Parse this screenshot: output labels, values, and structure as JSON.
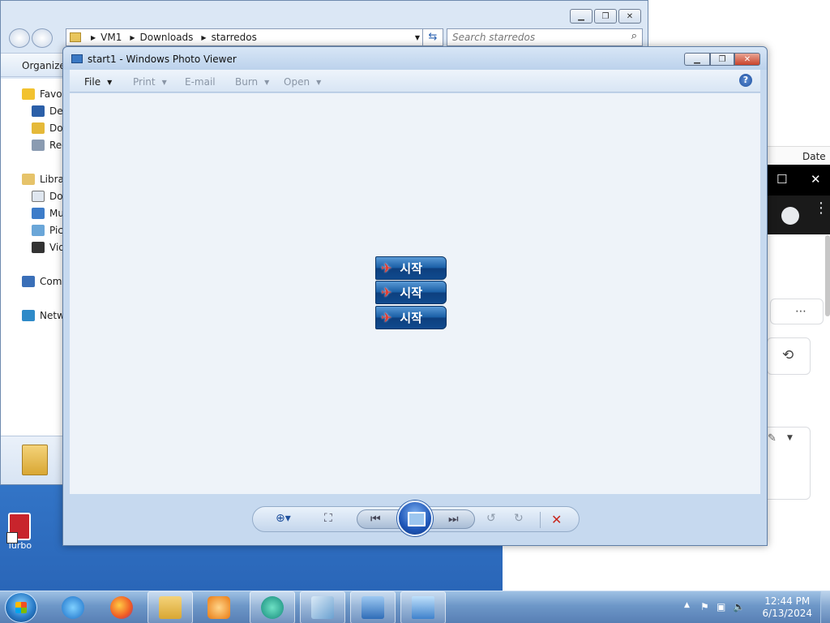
{
  "desktop": {
    "shortcut_label": "Turbo"
  },
  "browser": {
    "date_column": "Date r"
  },
  "explorer": {
    "breadcrumb": [
      "VM1",
      "Downloads",
      "starredos"
    ],
    "search_placeholder": "Search starredos",
    "organize_label": "Organize",
    "nav_items": [
      {
        "label": "Favorites",
        "icon": "star-icon"
      },
      {
        "label": "Desktop",
        "icon": "desktop-icon"
      },
      {
        "label": "Downloads",
        "icon": "downloads-icon"
      },
      {
        "label": "Recent Places",
        "icon": "recent-places-icon"
      },
      {
        "label": "Libraries",
        "icon": "libraries-icon"
      },
      {
        "label": "Documents",
        "icon": "documents-icon"
      },
      {
        "label": "Music",
        "icon": "music-icon"
      },
      {
        "label": "Pictures",
        "icon": "pictures-icon"
      },
      {
        "label": "Videos",
        "icon": "videos-icon"
      },
      {
        "label": "Computer",
        "icon": "computer-icon"
      },
      {
        "label": "Network",
        "icon": "network-icon"
      }
    ]
  },
  "viewer": {
    "title": "start1 - Windows Photo Viewer",
    "menu": {
      "file": "File",
      "print": "Print",
      "email": "E-mail",
      "burn": "Burn",
      "open": "Open"
    },
    "help": "?",
    "image_buttons": [
      "시작",
      "시작",
      "시작"
    ],
    "controls": {
      "zoom": "zoom-icon",
      "actual_size": "actual-size-icon",
      "previous": "previous-icon",
      "slideshow": "slideshow-icon",
      "next": "next-icon",
      "rotate_ccw": "rotate-counterclockwise-icon",
      "rotate_cw": "rotate-clockwise-icon",
      "delete": "delete-icon"
    }
  },
  "taskbar": {
    "apps": [
      "Internet Explorer",
      "Firefox",
      "Windows Explorer",
      "Media Player",
      "App",
      "App",
      "Remote Desktop",
      "Windows Photo Viewer"
    ],
    "time": "12:44 PM",
    "date": "6/13/2024"
  }
}
